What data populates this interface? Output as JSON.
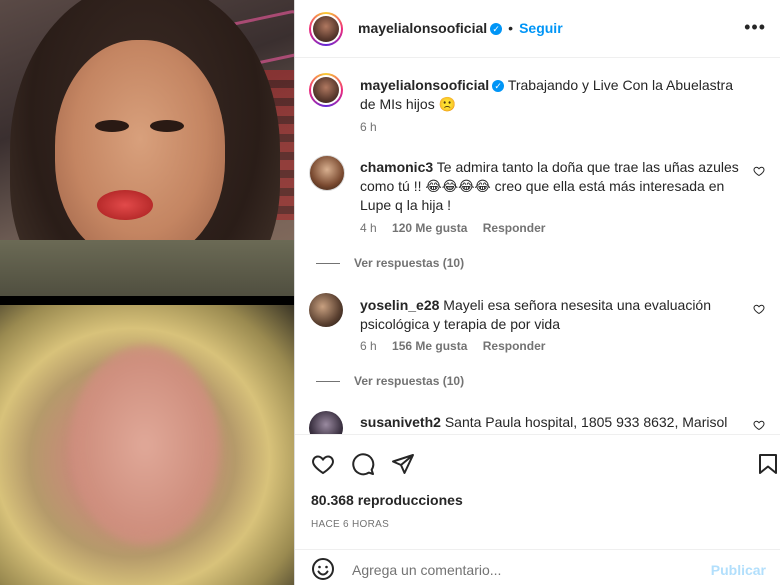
{
  "post": {
    "author": "mayelialonsooficial",
    "follow_label": "Seguir",
    "separator": "•",
    "more": "•••"
  },
  "caption": {
    "username": "mayelialonsooficial",
    "text": "Trabajando y Live Con la Abuelastra de MIs hijos 🙁",
    "time": "6 h"
  },
  "comments": [
    {
      "username": "chamonic3",
      "text": "Te admira tanto la doña que trae las uñas azules como tú !! 😂😂😂😂 creo que ella está más interesada en Lupe q la hija !",
      "time": "4 h",
      "likes": "120 Me gusta",
      "reply": "Responder",
      "view_replies": "Ver respuestas (10)"
    },
    {
      "username": "yoselin_e28",
      "text": "Mayeli esa señora nesesita una evaluación psicológica y terapia de por vida",
      "time": "6 h",
      "likes": "156 Me gusta",
      "reply": "Responder",
      "view_replies": "Ver respuestas (10)"
    },
    {
      "username": "susaniveth2",
      "text": "Santa Paula hospital, 1805 933 8632, Marisol"
    }
  ],
  "stats": {
    "views": "80.368 reproducciones",
    "posted": "HACE 6 HORAS"
  },
  "add_comment": {
    "placeholder": "Agrega un comentario...",
    "publish": "Publicar"
  },
  "colors": {
    "accent": "#0095f6",
    "publish_disabled": "#b2dffc",
    "muted": "#737373"
  },
  "icons": [
    "heart-icon",
    "comment-icon",
    "share-icon",
    "bookmark-icon",
    "emoji-icon",
    "more-icon",
    "verified-icon"
  ]
}
